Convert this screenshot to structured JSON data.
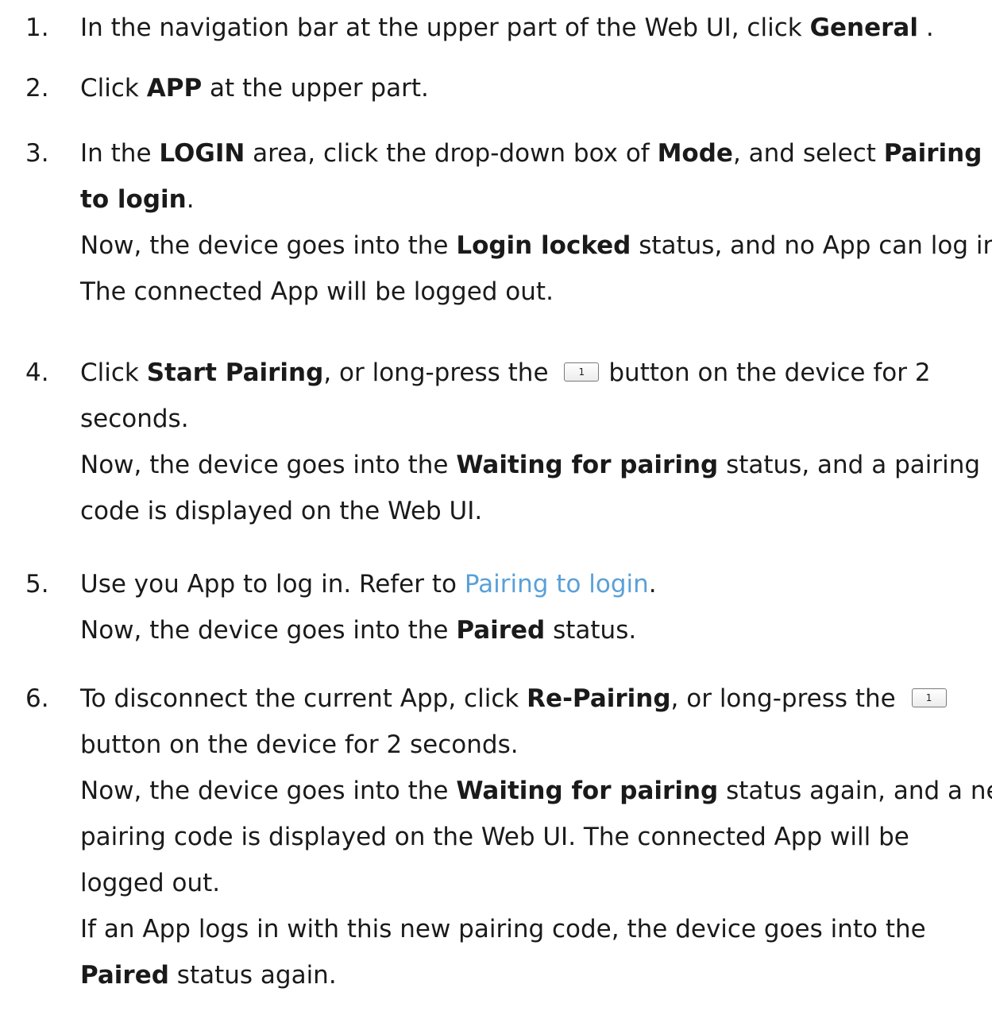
{
  "steps": [
    {
      "num": "1.",
      "lines": [
        {
          "p1": "In the navigation bar at the upper part of the Web UI, click ",
          "b1": "General",
          "p2": " ."
        }
      ]
    },
    {
      "num": "2.",
      "lines": [
        {
          "p1": "Click ",
          "b1": "APP",
          "p2": " at the upper part."
        }
      ]
    },
    {
      "num": "3.",
      "lines": [
        {
          "p1": "In the ",
          "b1": "LOGIN",
          "p2": " area, click the drop-down box of ",
          "b2": "Mode",
          "p3": ", and select ",
          "b3": "Pairing"
        },
        {
          "b1": "to login",
          "p1": "."
        },
        {
          "p1": "Now, the device goes into the ",
          "b1": "Login locked",
          "p2": " status, and no App can log in."
        },
        {
          "p1": "The connected App will be logged out."
        }
      ]
    },
    {
      "num": "4.",
      "lines": [
        {
          "p1": "Click ",
          "b1": "Start Pairing",
          "p2": ", or long-press the ",
          "key": "1",
          "p3": "button on the device for 2"
        },
        {
          "p1": "seconds."
        },
        {
          "p1": "Now, the device goes into the ",
          "b1": "Waiting for pairing",
          "p2": " status, and a pairing"
        },
        {
          "p1": "code is displayed on the Web UI."
        }
      ]
    },
    {
      "num": "5.",
      "lines": [
        {
          "p1": "Use you App to log in. Refer to ",
          "link": "Pairing to login",
          "p2": "."
        },
        {
          "p1": "Now, the device goes into the ",
          "b1": "Paired",
          "p2": " status."
        }
      ]
    },
    {
      "num": "6.",
      "lines": [
        {
          "p1": "To disconnect the current App, click ",
          "b1": "Re-Pairing",
          "p2": ", or long-press the ",
          "key": "1"
        },
        {
          "p1": "button on the device for 2 seconds."
        },
        {
          "p1": "Now, the device goes into the ",
          "b1": "Waiting for pairing",
          "p2": " status again, and a new"
        },
        {
          "p1": "pairing code is displayed on the Web UI. The connected App will be"
        },
        {
          "p1": "logged out."
        },
        {
          "p1": "If an App logs in with this new pairing code, the device goes into the"
        },
        {
          "b1": "Paired",
          "p1": " status again."
        }
      ]
    }
  ],
  "colors": {
    "text": "#1a1a1a",
    "link": "#5aa0d8"
  }
}
